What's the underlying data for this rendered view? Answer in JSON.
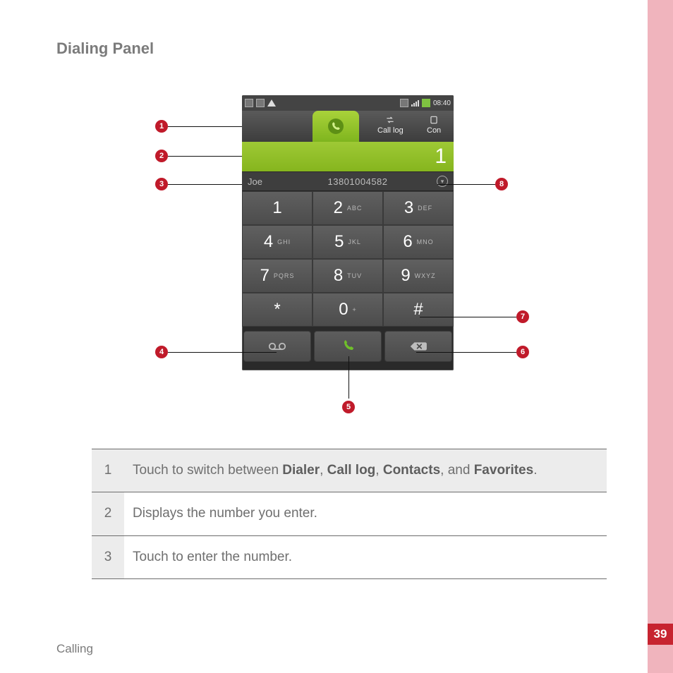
{
  "page": {
    "heading": "Dialing Panel",
    "footer_section": "Calling",
    "page_number": "39"
  },
  "phone": {
    "status_time": "08:40",
    "tabs": {
      "active_icon": "phone-icon",
      "call_log_label": "Call log",
      "contacts_label": "Con"
    },
    "display_number": "1",
    "suggest_name": "Joe",
    "suggest_number": "13801004582",
    "keys": [
      {
        "digit": "1",
        "letters": ""
      },
      {
        "digit": "2",
        "letters": "ABC"
      },
      {
        "digit": "3",
        "letters": "DEF"
      },
      {
        "digit": "4",
        "letters": "GHI"
      },
      {
        "digit": "5",
        "letters": "JKL"
      },
      {
        "digit": "6",
        "letters": "MNO"
      },
      {
        "digit": "7",
        "letters": "PQRS"
      },
      {
        "digit": "8",
        "letters": "TUV"
      },
      {
        "digit": "9",
        "letters": "WXYZ"
      },
      {
        "digit": "*",
        "letters": ""
      },
      {
        "digit": "0",
        "letters": "+"
      },
      {
        "digit": "#",
        "letters": ""
      }
    ]
  },
  "callouts": {
    "c1": "1",
    "c2": "2",
    "c3": "3",
    "c4": "4",
    "c5": "5",
    "c6": "6",
    "c7": "7",
    "c8": "8"
  },
  "table": {
    "rows": [
      {
        "n": "1",
        "html": "Touch to switch between <b>Dialer</b>, <b>Call log</b>, <b>Contacts</b>, and <b>Favorites</b>."
      },
      {
        "n": "2",
        "html": "Displays the number you enter."
      },
      {
        "n": "3",
        "html": "Touch to enter the number."
      }
    ]
  }
}
